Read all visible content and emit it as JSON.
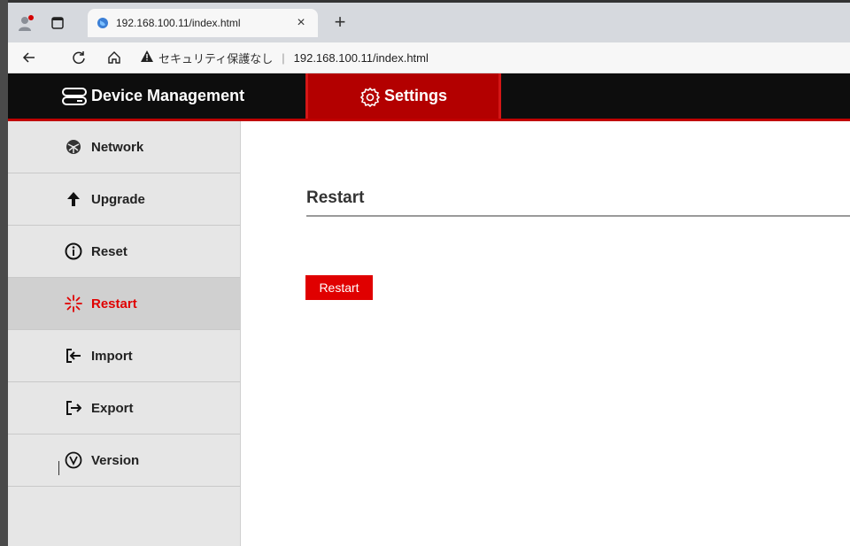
{
  "browser": {
    "tab_title": "192.168.100.11/index.html",
    "tab_close": "×",
    "new_tab": "+",
    "security_label": "セキュリティ保護なし",
    "separator": "|",
    "url": "192.168.100.11/index.html"
  },
  "app": {
    "device_tab": "Device Management",
    "settings_tab": "Settings",
    "accent": "#e00000"
  },
  "sidebar": {
    "items": [
      {
        "label": "Network",
        "icon": "network-icon"
      },
      {
        "label": "Upgrade",
        "icon": "arrow-up-icon"
      },
      {
        "label": "Reset",
        "icon": "info-icon"
      },
      {
        "label": "Restart",
        "icon": "spinner-icon",
        "active": true
      },
      {
        "label": "Import",
        "icon": "import-icon"
      },
      {
        "label": "Export",
        "icon": "export-icon"
      },
      {
        "label": "Version",
        "icon": "version-icon"
      }
    ]
  },
  "main": {
    "title": "Restart",
    "button": "Restart"
  }
}
